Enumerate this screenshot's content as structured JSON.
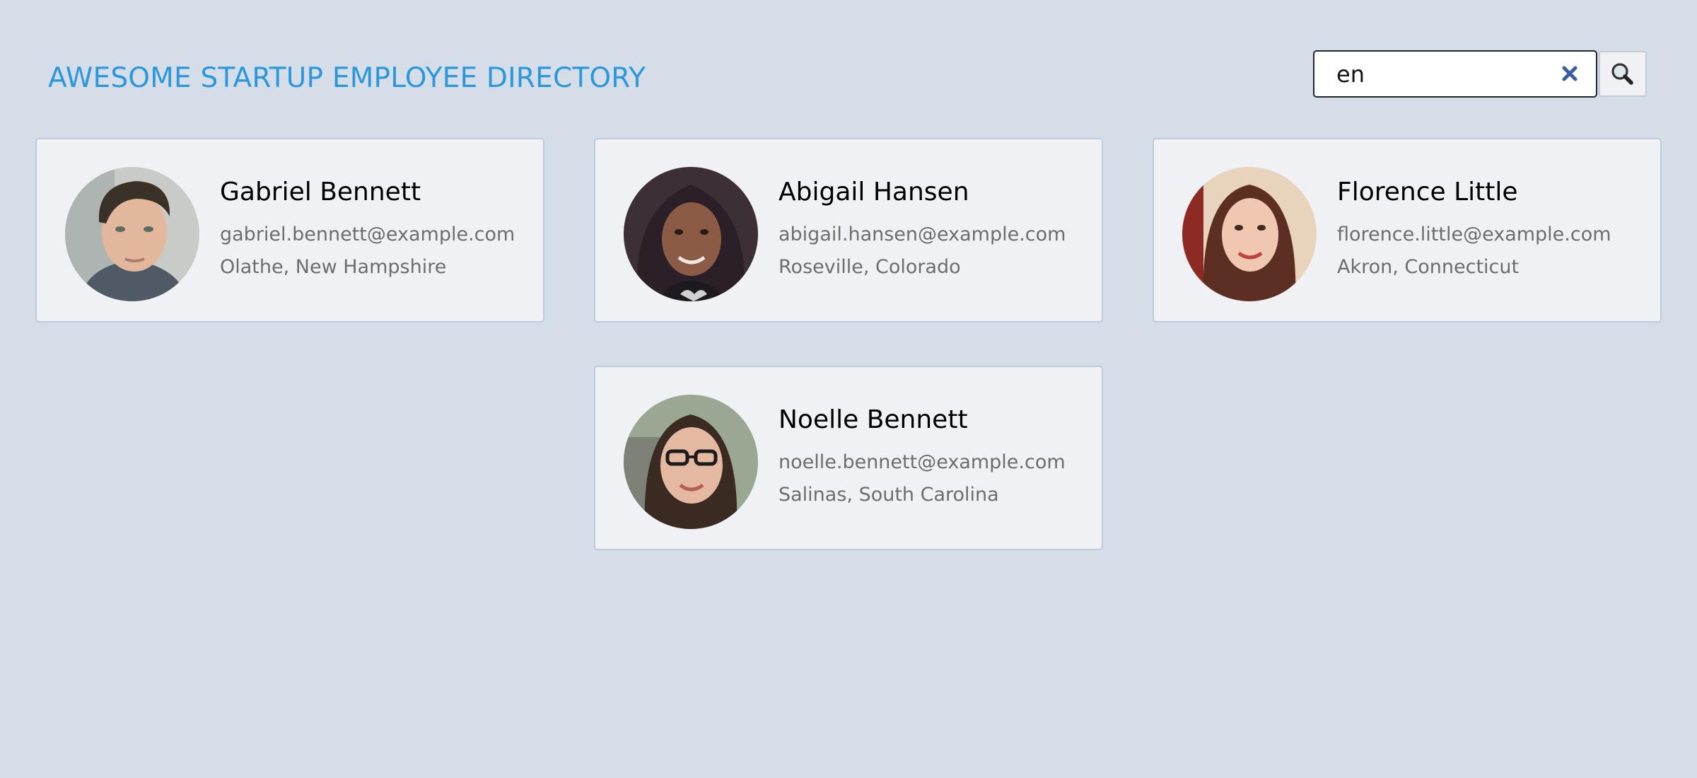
{
  "header": {
    "title": "AWESOME STARTUP EMPLOYEE DIRECTORY"
  },
  "search": {
    "value": "en",
    "clear_icon": "close-icon",
    "search_icon": "search-icon",
    "clear_icon_color": "#3b5fa6"
  },
  "employees": [
    {
      "name": "Gabriel Bennett",
      "email": "gabriel.bennett@example.com",
      "location": "Olathe, New Hampshire"
    },
    {
      "name": "Abigail Hansen",
      "email": "abigail.hansen@example.com",
      "location": "Roseville, Colorado"
    },
    {
      "name": "Florence Little",
      "email": "florence.little@example.com",
      "location": "Akron, Connecticut"
    },
    {
      "name": "Noelle Bennett",
      "email": "noelle.bennett@example.com",
      "location": "Salinas, South Carolina"
    }
  ],
  "colors": {
    "page_background": "#d5dde9",
    "title": "#2d98d9",
    "card_background": "#eff1f4",
    "card_border": "#bfcadb",
    "secondary_text": "#6d6d6d"
  }
}
